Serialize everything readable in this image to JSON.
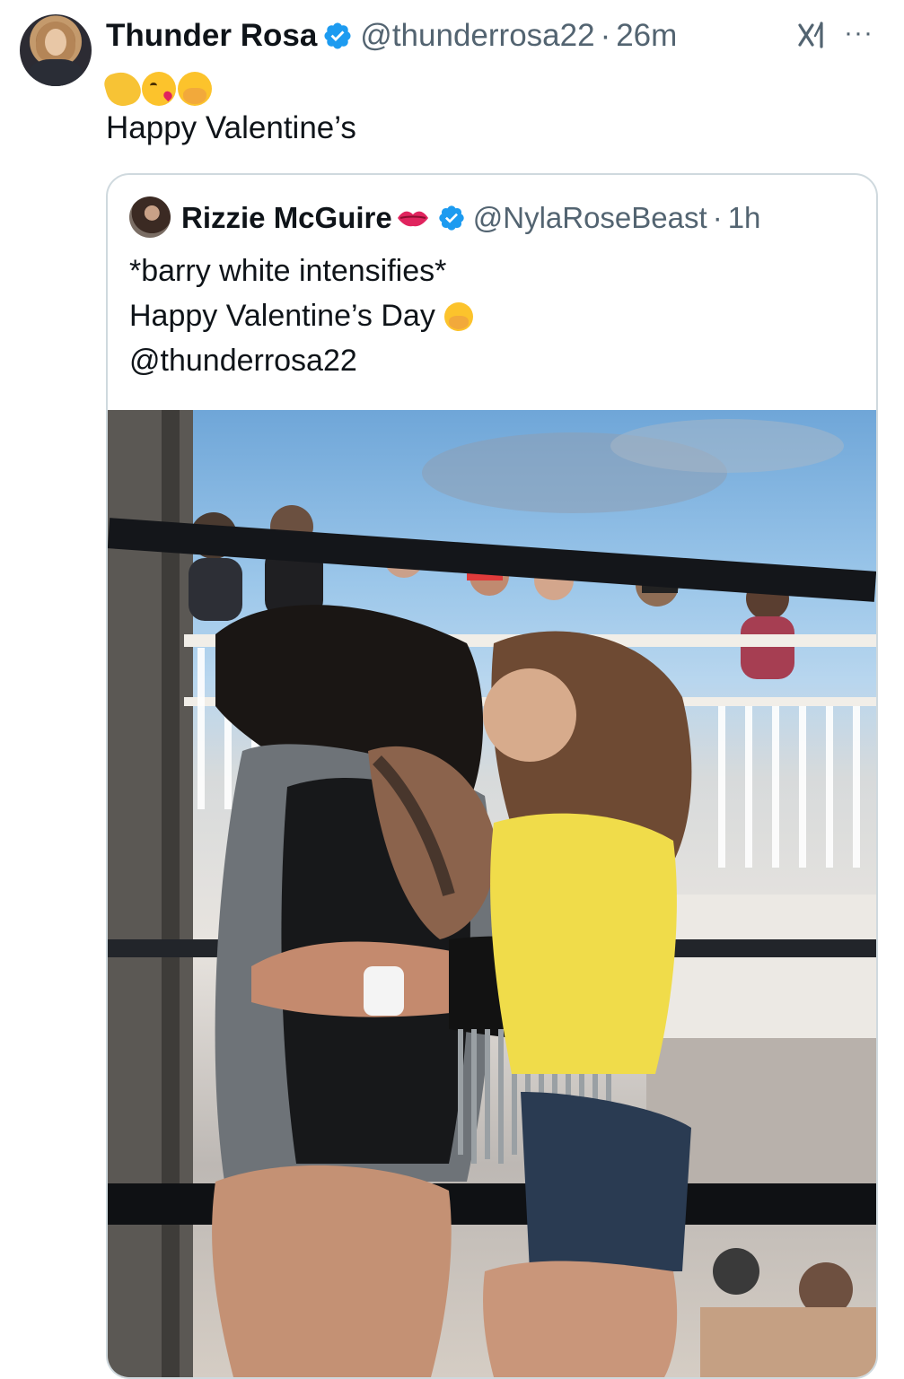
{
  "tweet": {
    "author_name": "Thunder Rosa",
    "author_handle": "@thunderrosa22",
    "separator": "·",
    "time": "26m",
    "emoji_icons": [
      "clapping-hands-icon",
      "face-blowing-kiss-icon",
      "face-with-hand-over-mouth-icon"
    ],
    "text": "Happy Valentine’s",
    "more_label": "···"
  },
  "quoted_tweet": {
    "author_name": "Rizzie McGuire",
    "author_badge_icon": "kiss-mark-lips-icon",
    "author_handle": "@NylaRoseBeast",
    "separator": "·",
    "time": "1h",
    "lines": [
      "*barry white intensifies*",
      "Happy Valentine’s Day",
      "@thunderrosa22"
    ],
    "line_emoji_icon": "face-with-hand-over-mouth-icon"
  },
  "colors": {
    "text_primary": "#0f1419",
    "text_secondary": "#536471",
    "verified_blue": "#1d9bf0",
    "border": "#cfd9de"
  }
}
